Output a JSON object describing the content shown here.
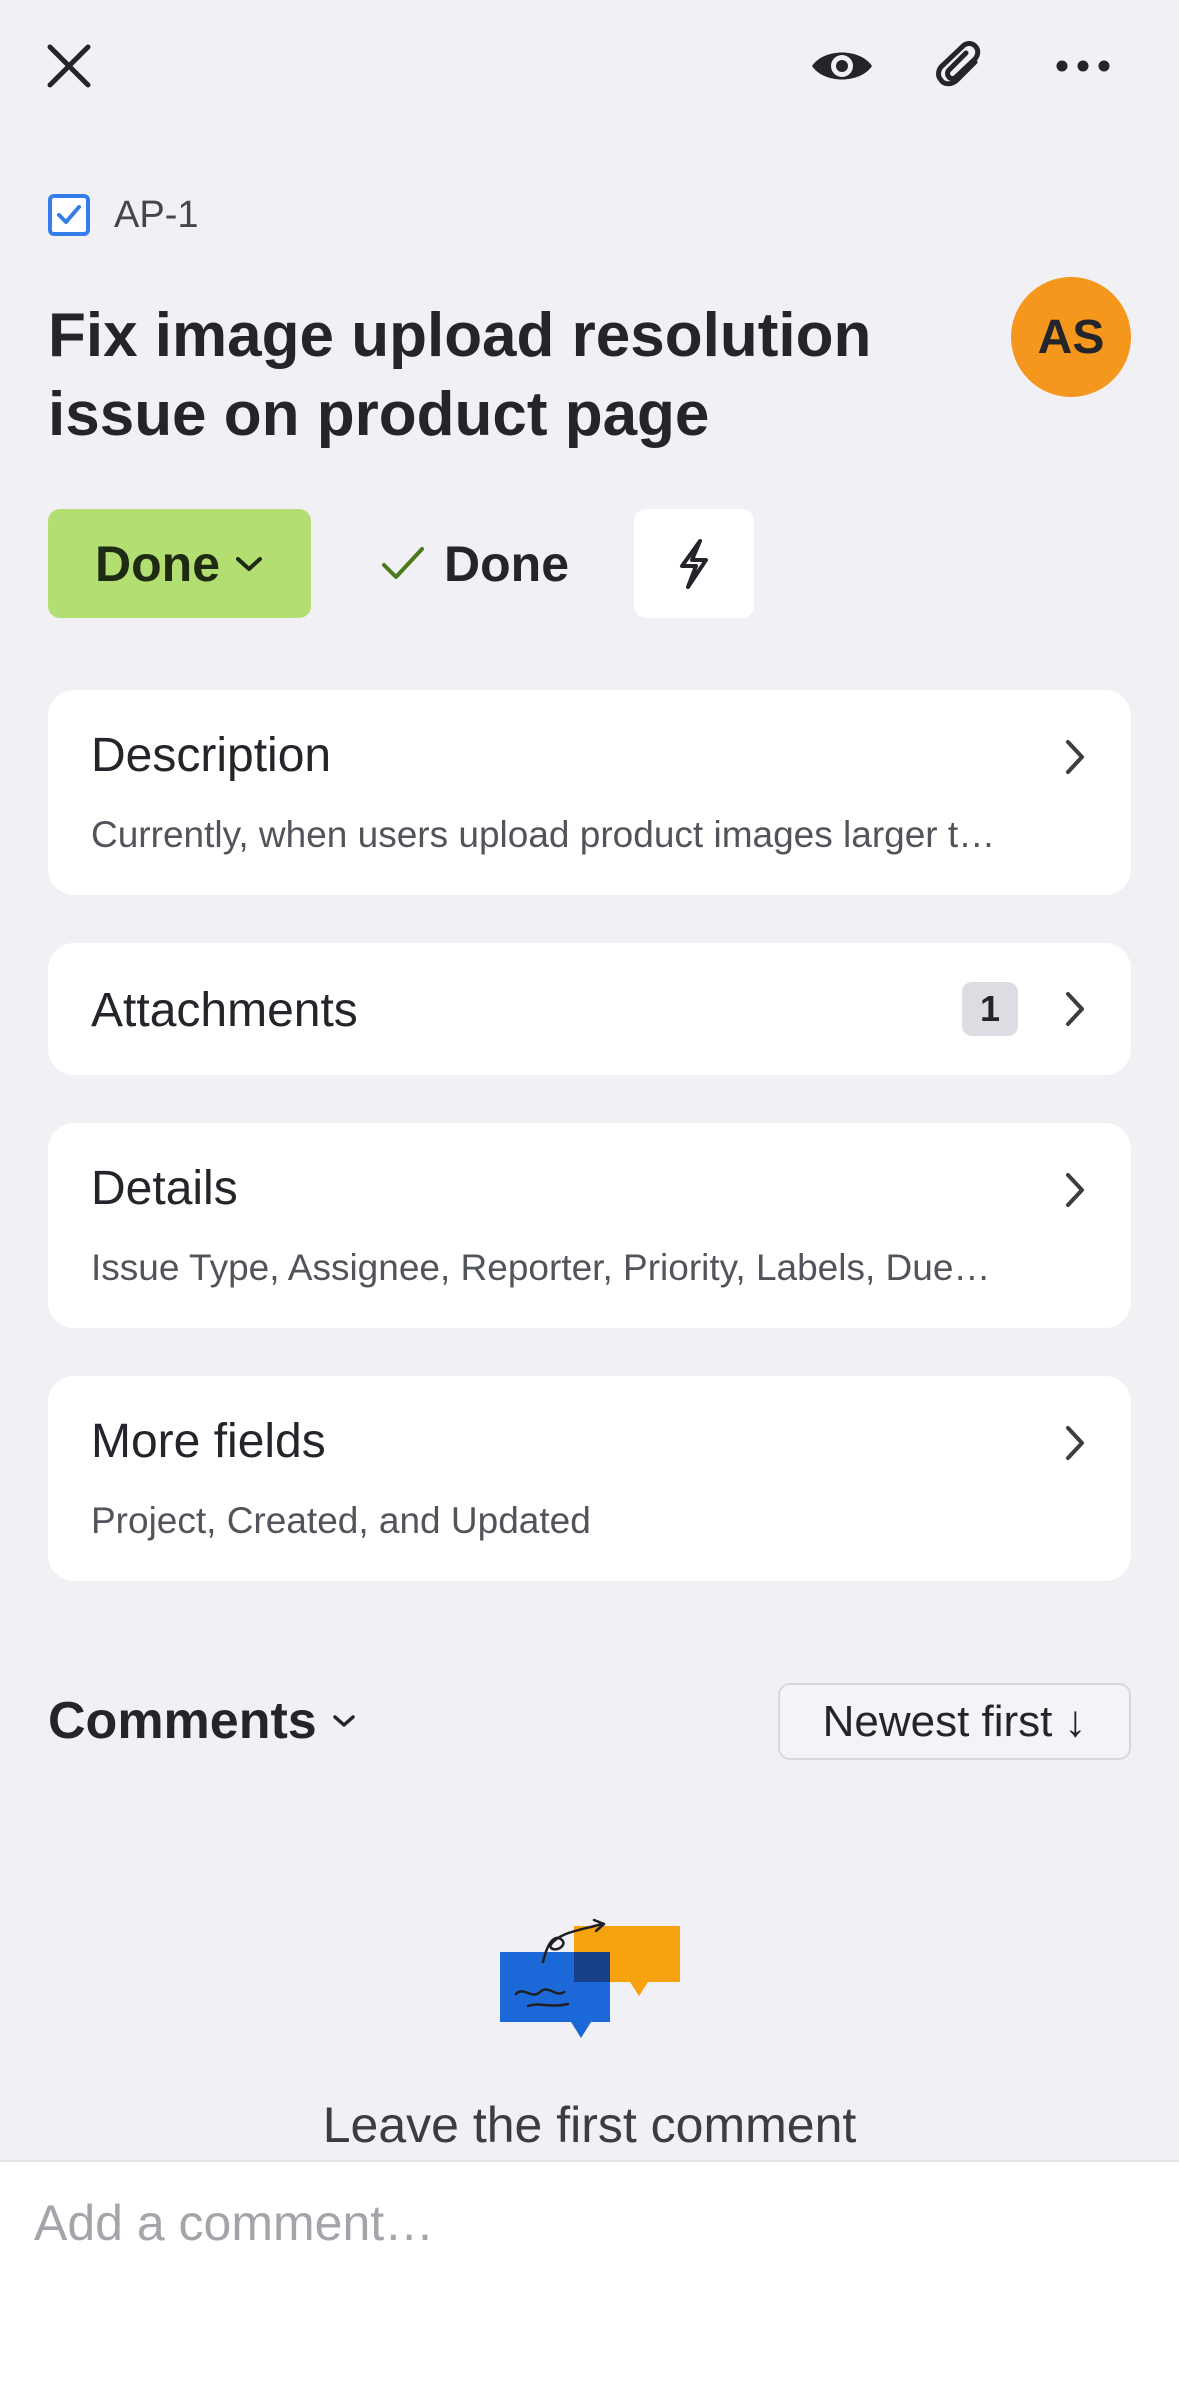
{
  "toolbar": {
    "close_icon": "close-icon",
    "watch_icon": "eye-icon",
    "attach_icon": "paperclip-icon",
    "more_icon": "more-icon"
  },
  "issue": {
    "key": "AP-1",
    "title": "Fix image upload resolution issue on product page",
    "assignee_initials": "AS",
    "avatar_color": "#f5961d"
  },
  "status": {
    "button_label": "Done",
    "button_color": "#b3df72",
    "resolution_label": "Done"
  },
  "cards": {
    "description": {
      "title": "Description",
      "preview": "Currently, when users upload product images larger t…"
    },
    "attachments": {
      "title": "Attachments",
      "count": "1"
    },
    "details": {
      "title": "Details",
      "preview": "Issue Type, Assignee, Reporter, Priority, Labels, Due…"
    },
    "more_fields": {
      "title": "More fields",
      "preview": "Project, Created, and Updated"
    }
  },
  "comments": {
    "header": "Comments",
    "sort_label": "Newest first",
    "sort_arrow": "↓",
    "empty_text": "Leave the first comment",
    "input_placeholder": "Add a comment…"
  }
}
